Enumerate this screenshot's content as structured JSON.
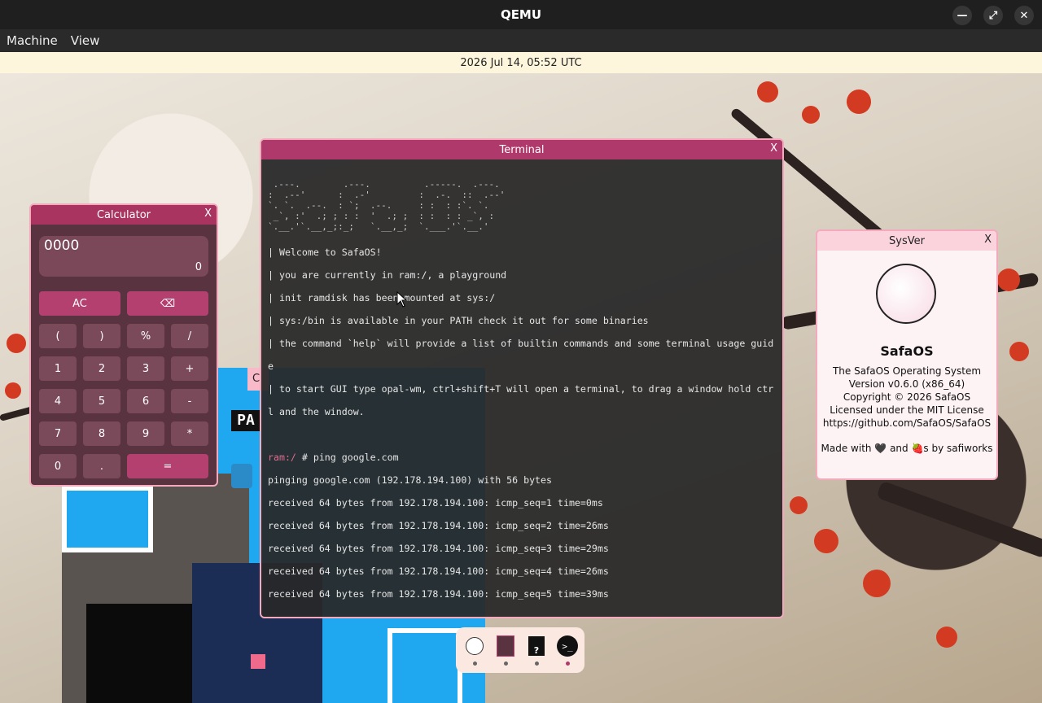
{
  "app": {
    "title": "QEMU"
  },
  "menubar": {
    "items": [
      "Machine",
      "View"
    ]
  },
  "datebar": {
    "text": "2026 Jul 14, 05:52 UTC"
  },
  "calculator": {
    "title": "Calculator",
    "close": "X",
    "expression": "0000",
    "result": "0",
    "buttons": [
      "AC",
      "⌫",
      "(",
      ")",
      "%",
      "/",
      "1",
      "2",
      "3",
      "+",
      "4",
      "5",
      "6",
      "-",
      "7",
      "8",
      "9",
      "*",
      "0",
      ".",
      "="
    ]
  },
  "terminal": {
    "title": "Terminal",
    "close": "X",
    "logo": " .---.        .---.          .-----.  .---.\n:  .--'      :  .-'         :  .-.  ::  .--'\n`. `.  .--.  : `;  .--.     : :  : :`. `.\n _`, :'  .; ; : :  '  .; ;  : :  : : _`, :\n`.__.'`.__,_;:_;   `.__,_;  `.___.'`.__.'",
    "lines": [
      "| Welcome to SafaOS!",
      "| you are currently in ram:/, a playground",
      "| init ramdisk has been mounted at sys:/",
      "| sys:/bin is available in your PATH check it out for some binaries",
      "| the command `help` will provide a list of builtin commands and some terminal usage guid",
      "e",
      "| to start GUI type opal-wm, ctrl+shift+T will open a terminal, to drag a window hold ctr",
      "l and the window."
    ],
    "prompt": "ram:/",
    "command": " # ping google.com",
    "output": [
      "pinging google.com (192.178.194.100) with 56 bytes",
      "received 64 bytes from 192.178.194.100: icmp_seq=1 time=0ms",
      "received 64 bytes from 192.178.194.100: icmp_seq=2 time=26ms",
      "received 64 bytes from 192.178.194.100: icmp_seq=3 time=29ms",
      "received 64 bytes from 192.178.194.100: icmp_seq=4 time=26ms",
      "received 64 bytes from 192.178.194.100: icmp_seq=5 time=39ms"
    ]
  },
  "sysver": {
    "title": "SysVer",
    "close": "X",
    "name": "SafaOS",
    "lines": [
      "The SafaOS Operating System",
      "Version v0.6.0 (x86_64)",
      "Copyright © 2026 SafaOS",
      "Licensed under the MIT License",
      "https://github.com/SafaOS/SafaOS"
    ],
    "made_with": "Made with 🖤 and 🍓s by safiworks"
  },
  "game": {
    "title_fragment": "C",
    "hud_text": "PA"
  },
  "dock": {
    "items": [
      {
        "icon": "sysver-icon"
      },
      {
        "icon": "calculator-icon"
      },
      {
        "icon": "help-file-icon",
        "glyph": "?"
      },
      {
        "icon": "terminal-icon",
        "glyph": ">_"
      }
    ]
  },
  "colors": {
    "accent": "#b0396c",
    "window_border": "#f4a9bd",
    "terminal_bg": "#282828"
  }
}
